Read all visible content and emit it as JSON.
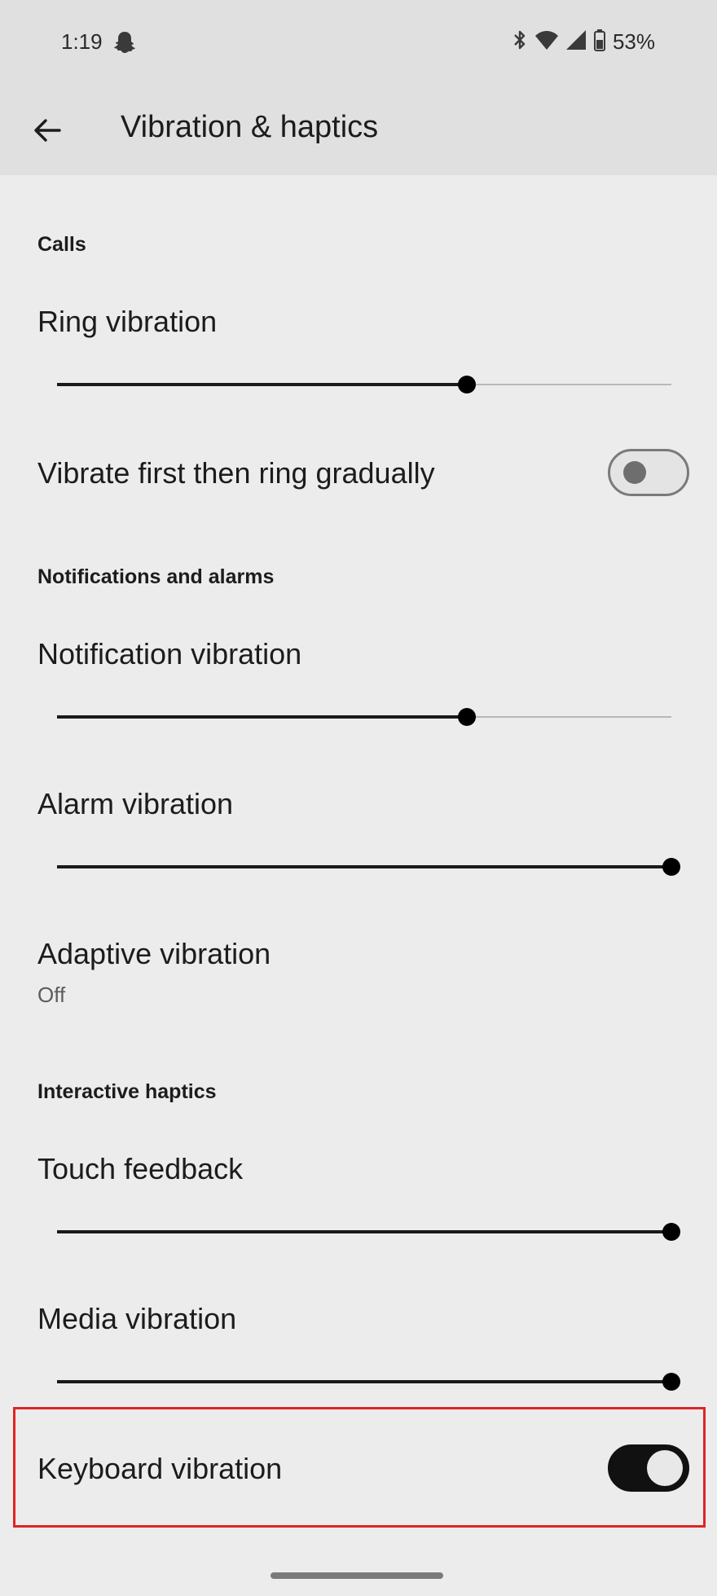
{
  "status_bar": {
    "time": "1:19",
    "battery": "53%",
    "icons": [
      "snapchat-ghost-icon",
      "bluetooth-icon",
      "wifi-icon",
      "cell-signal-icon",
      "battery-icon"
    ]
  },
  "app_bar": {
    "back_icon": "arrow-left-icon",
    "title": "Vibration & haptics"
  },
  "sections": {
    "calls": {
      "header": "Calls",
      "ring_vibration": {
        "label": "Ring vibration",
        "level": 0.667
      },
      "vibrate_first": {
        "label": "Vibrate first then ring gradually",
        "checked": false
      }
    },
    "notifications_alarms": {
      "header": "Notifications and alarms",
      "notification_vibration": {
        "label": "Notification vibration",
        "level": 0.667
      },
      "alarm_vibration": {
        "label": "Alarm vibration",
        "level": 1.0
      },
      "adaptive_vibration": {
        "label": "Adaptive vibration",
        "summary": "Off"
      }
    },
    "interactive_haptics": {
      "header": "Interactive haptics",
      "touch_feedback": {
        "label": "Touch feedback",
        "level": 1.0
      },
      "media_vibration": {
        "label": "Media vibration",
        "level": 1.0
      },
      "keyboard_vibration": {
        "label": "Keyboard vibration",
        "checked": true
      }
    }
  },
  "colors": {
    "background": "#ececec",
    "bar": "#e0e0e0",
    "highlight": "#e02424"
  }
}
